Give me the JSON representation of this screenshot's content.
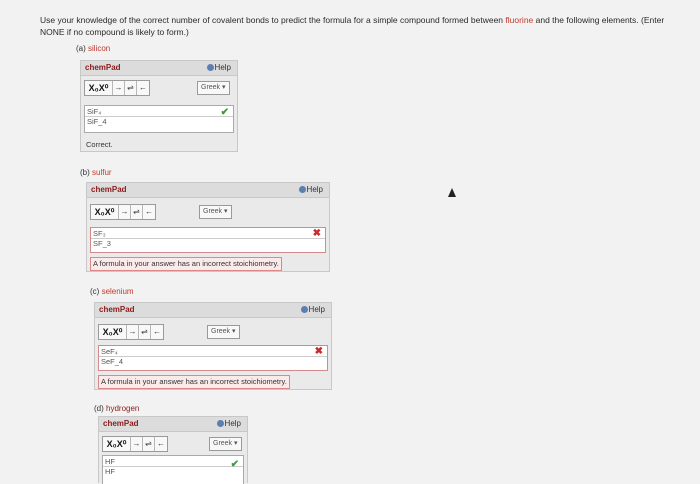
{
  "instructions": {
    "part1": "Use your knowledge of the correct number of covalent bonds to predict the formula for a simple compound formed between ",
    "accent": "fluorine",
    "part2": " and the following elements. (Enter NONE if no compound is likely to form.)"
  },
  "pad_title": "chemPad",
  "help_label": "Help",
  "greek_label": "Greek",
  "toolbar": {
    "x_label": "X₀X⁰",
    "arrow_right": "→",
    "equilibrium": "⇌",
    "arrow_left": "←"
  },
  "questions": [
    {
      "letter": "(a)",
      "element": "silicon",
      "answer_display": "SiF₄",
      "answer_raw": "SiF_4",
      "status": "correct",
      "feedback": "Correct."
    },
    {
      "letter": "(b)",
      "element": "sulfur",
      "answer_display": "SF₃",
      "answer_raw": "SF_3",
      "status": "incorrect",
      "feedback": "A formula in your answer has an incorrect stoichiometry."
    },
    {
      "letter": "(c)",
      "element": "selenium",
      "answer_display": "SeF₄",
      "answer_raw": "SeF_4",
      "status": "incorrect",
      "feedback": "A formula in your answer has an incorrect stoichiometry."
    },
    {
      "letter": "(d)",
      "element": "hydrogen",
      "answer_display": "HF",
      "answer_raw": "HF",
      "status": "correct",
      "feedback": ""
    }
  ],
  "icons": {
    "correct": "checkmark-icon",
    "incorrect": "x-mark-icon",
    "help": "help-icon",
    "dropdown": "dropdown-triangle-icon"
  },
  "colors": {
    "accent": "#c0392b",
    "correct": "#3b9a3b",
    "incorrect": "#cc2a2a"
  }
}
